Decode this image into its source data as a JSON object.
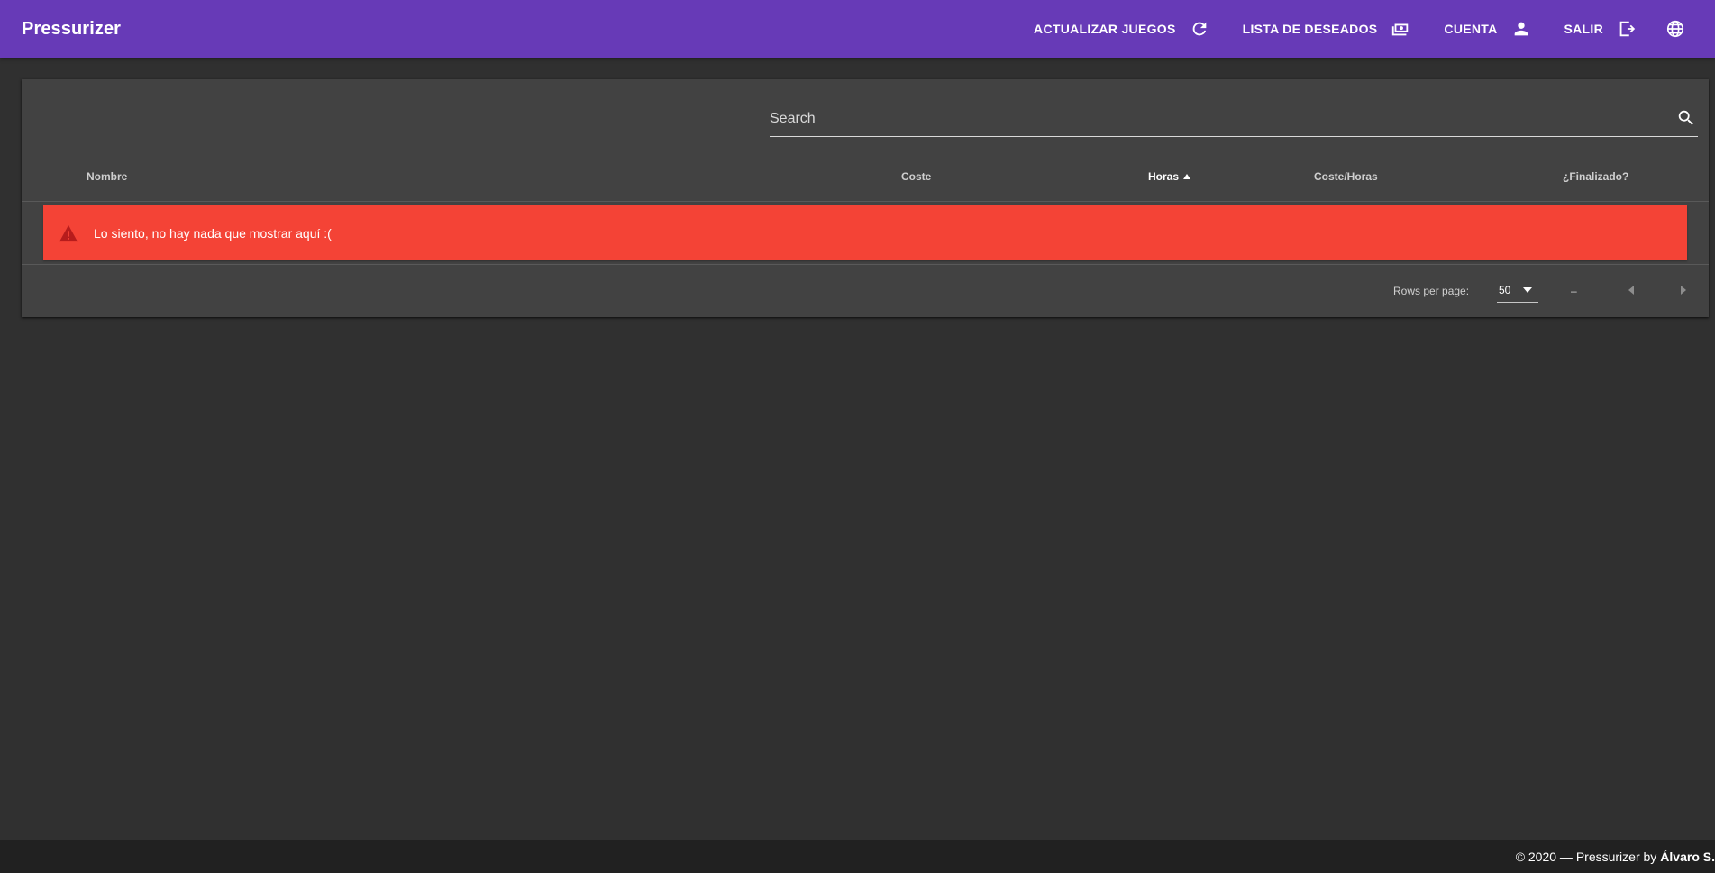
{
  "app": {
    "title": "Pressurizer",
    "bar_color": "#673ab7"
  },
  "nav": {
    "actions": [
      {
        "label": "ACTUALIZAR JUEGOS",
        "icon": "refresh-icon"
      },
      {
        "label": "LISTA DE DESEADOS",
        "icon": "money-icon"
      },
      {
        "label": "CUENTA",
        "icon": "account-icon"
      },
      {
        "label": "SALIR",
        "icon": "logout-icon"
      }
    ],
    "language_icon": "globe-icon"
  },
  "table": {
    "search": {
      "placeholder": "Search",
      "value": "",
      "icon": "search-icon"
    },
    "columns": [
      {
        "label": "Nombre"
      },
      {
        "label": "Coste"
      },
      {
        "label": "Horas",
        "sorted": "asc"
      },
      {
        "label": "Coste/Horas"
      },
      {
        "label": "¿Finalizado?"
      }
    ],
    "empty_message": "Lo siento, no hay nada que mostrar aquí :(",
    "empty_icon": "warning-icon",
    "error_color": "#f44336",
    "pagination": {
      "rows_per_page_label": "Rows per page:",
      "rows_per_page_value": "50",
      "range": "–",
      "prev_icon": "chevron-left-icon",
      "next_icon": "chevron-right-icon"
    }
  },
  "footer": {
    "text": "© 2020 — Pressurizer by",
    "author": "Álvaro S."
  }
}
